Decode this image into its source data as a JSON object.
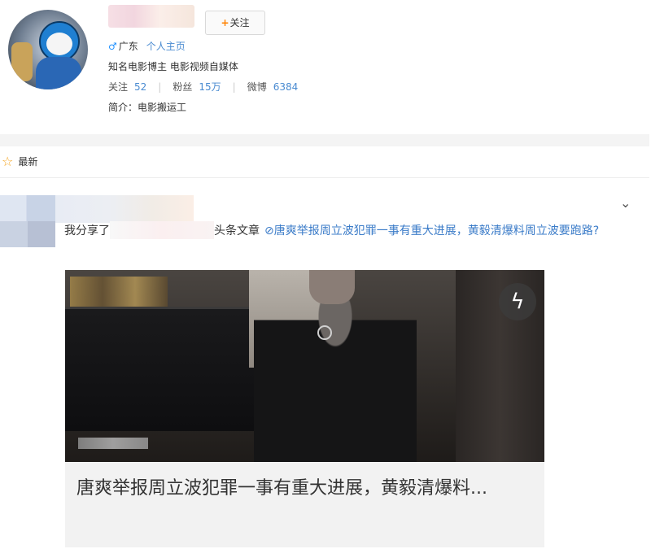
{
  "profile": {
    "follow_label": "关注",
    "location": "广东",
    "homepage_link": "个人主页",
    "description": "知名电影博主 电影视频自媒体",
    "stats": [
      {
        "label": "关注",
        "value": "52"
      },
      {
        "label": "粉丝",
        "value": "15万"
      },
      {
        "label": "微博",
        "value": "6384"
      }
    ],
    "bio": "简介：电影搬运工"
  },
  "feed": {
    "tab_label": "最新"
  },
  "post": {
    "share_prefix": "我分享了",
    "share_type": "头条文章",
    "article_link": "唐爽举报周立波犯罪一事有重大进展，黄毅清爆料周立波要跑路?",
    "card_title": "唐爽举报周立波犯罪一事有重大进展，黄毅清爆料..."
  },
  "colors": {
    "accent": "#ff8200",
    "link": "#3a7bc8"
  },
  "icons": [
    "male-icon",
    "star-icon",
    "chevron-down-icon",
    "link-icon",
    "flash-icon"
  ]
}
